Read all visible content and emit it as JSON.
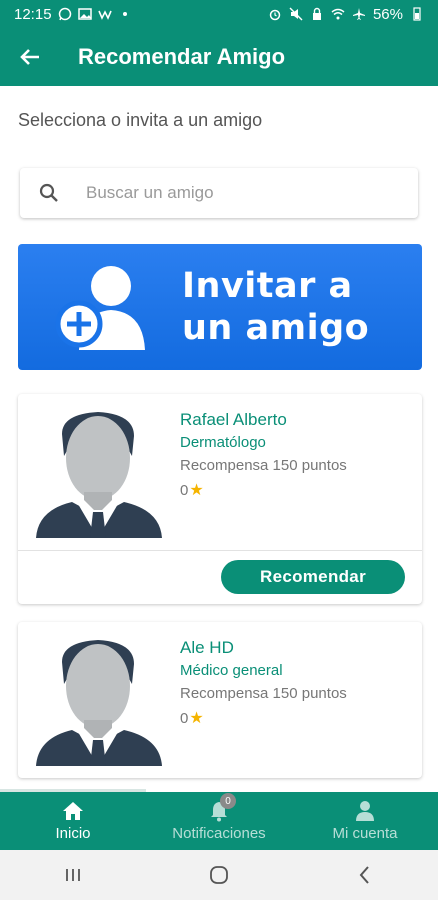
{
  "status_bar": {
    "time": "12:15",
    "battery": "56%",
    "left_icons": [
      "whatsapp-icon",
      "image-icon",
      "app-icon",
      "dot-icon"
    ],
    "right_icons": [
      "alarm-icon",
      "mute-icon",
      "lock-icon",
      "wifi-icon",
      "airplane-icon",
      "battery-icon"
    ]
  },
  "app_bar": {
    "title": "Recomendar Amigo",
    "back_icon": "arrow-left-icon"
  },
  "subtitle": "Selecciona o invita a un amigo",
  "search": {
    "placeholder": "Buscar un amigo",
    "value": "",
    "icon": "search-icon"
  },
  "invite_banner": {
    "line1": "Invitar a",
    "line2": "un amigo",
    "icon": "add-user-icon"
  },
  "friends": [
    {
      "name": "Rafael Alberto",
      "specialty": "Dermatólogo",
      "reward": "Recompensa 150 puntos",
      "rating": "0",
      "button_label": "Recomendar"
    },
    {
      "name": "Ale HD",
      "specialty": "Médico general",
      "reward": "Recompensa 150 puntos",
      "rating": "0"
    }
  ],
  "bottom_nav": {
    "items": [
      {
        "label": "Inicio",
        "icon": "home-icon",
        "active": true
      },
      {
        "label": "Notificaciones",
        "icon": "bell-icon",
        "badge": "0"
      },
      {
        "label": "Mi cuenta",
        "icon": "person-icon"
      }
    ]
  },
  "system_nav": [
    "recents-icon",
    "home-circle-icon",
    "back-chevron-icon"
  ],
  "colors": {
    "primary": "#0a8f77",
    "banner_blue": "#1a73e8",
    "star": "#f5b400"
  }
}
